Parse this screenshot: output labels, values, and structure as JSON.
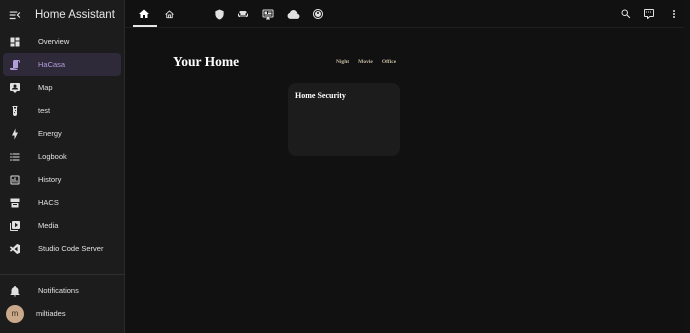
{
  "app": {
    "title": "Home Assistant"
  },
  "sidebar": {
    "items": [
      {
        "label": "Overview",
        "icon": "view-dashboard-icon"
      },
      {
        "label": "HaCasa",
        "icon": "script-icon",
        "active": true
      },
      {
        "label": "Map",
        "icon": "map-account-icon"
      },
      {
        "label": "test",
        "icon": "test-tube-icon"
      },
      {
        "label": "Energy",
        "icon": "lightning-bolt-icon"
      },
      {
        "label": "Logbook",
        "icon": "format-list-bulleted-icon"
      },
      {
        "label": "History",
        "icon": "chart-box-icon"
      },
      {
        "label": "HACS",
        "icon": "hacs-icon"
      },
      {
        "label": "Media",
        "icon": "play-box-multiple-icon"
      },
      {
        "label": "Studio Code Server",
        "icon": "vscode-icon"
      }
    ],
    "notifications_label": "Notifications",
    "user": {
      "name": "miltiades",
      "initial": "m"
    }
  },
  "tabs": [
    {
      "icon": "home-icon",
      "active": true
    },
    {
      "icon": "home-floor-icon"
    },
    {
      "icon": "shield-icon"
    },
    {
      "icon": "sofa-icon"
    },
    {
      "icon": "monitor-dashboard-icon"
    },
    {
      "icon": "cloud-icon"
    },
    {
      "icon": "robot-vacuum-icon"
    }
  ],
  "toolbar": {
    "search_icon": "magnify-icon",
    "assist_icon": "comment-processing-icon",
    "menu_icon": "dots-vertical-icon"
  },
  "main": {
    "title": "Your Home",
    "scenes": [
      "Night",
      "Movie",
      "Office"
    ],
    "card": {
      "name": "Home Security"
    }
  },
  "colors": {
    "background": "#111111",
    "sidebar": "#1c1c1c",
    "active": "#b39ddb",
    "card": "#1c1c1c",
    "scene_text": "#c9bda6"
  }
}
